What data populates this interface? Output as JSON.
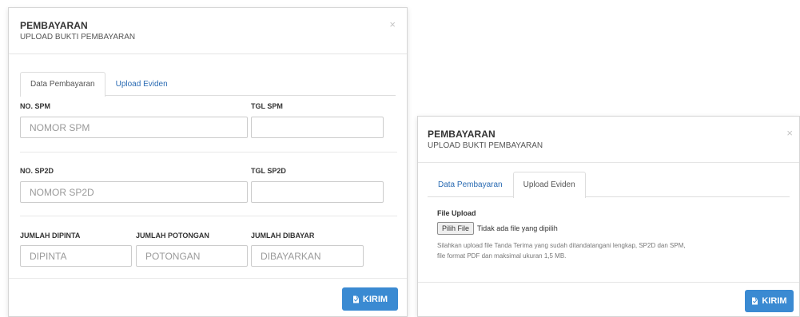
{
  "left_modal": {
    "title": "PEMBAYARAN",
    "subtitle": "UPLOAD BUKTI PEMBAYARAN",
    "close": "×",
    "tabs": [
      {
        "label": "Data Pembayaran",
        "active": true
      },
      {
        "label": "Upload Eviden",
        "active": false
      }
    ],
    "fields": {
      "no_spm": {
        "label": "NO. SPM",
        "placeholder": "NOMOR SPM",
        "value": ""
      },
      "tgl_spm": {
        "label": "TGL SPM",
        "placeholder": "",
        "value": ""
      },
      "no_sp2d": {
        "label": "NO. SP2D",
        "placeholder": "NOMOR SP2D",
        "value": ""
      },
      "tgl_sp2d": {
        "label": "TGL SP2D",
        "placeholder": "",
        "value": ""
      },
      "jumlah_dipinta": {
        "label": "JUMLAH DIPINTA",
        "placeholder": "DIPINTA",
        "value": ""
      },
      "jumlah_potongan": {
        "label": "JUMLAH POTONGAN",
        "placeholder": "POTONGAN",
        "value": ""
      },
      "jumlah_dibayar": {
        "label": "JUMLAH DIBAYAR",
        "placeholder": "DIBAYARKAN",
        "value": ""
      }
    },
    "submit_label": "KIRIM"
  },
  "right_modal": {
    "title": "PEMBAYARAN",
    "subtitle": "UPLOAD BUKTI PEMBAYARAN",
    "close": "×",
    "tabs": [
      {
        "label": "Data Pembayaran",
        "active": false
      },
      {
        "label": "Upload Eviden",
        "active": true
      }
    ],
    "file_upload": {
      "label": "File Upload",
      "button_label": "Pilih File",
      "status": "Tidak ada file yang dipilih",
      "help_line_1": "Silahkan upload file Tanda Terima yang sudah ditandatangani lengkap, SP2D dan SPM,",
      "help_line_2": "file format PDF dan maksimal ukuran 1,5 MB."
    },
    "submit_label": "KIRIM"
  },
  "colors": {
    "primary_button": "#3a8ad2",
    "link_tab": "#2a6bb3",
    "border": "#cccccc"
  },
  "icons": {
    "submit_icon": "file-icon",
    "close_icon": "close-icon"
  }
}
